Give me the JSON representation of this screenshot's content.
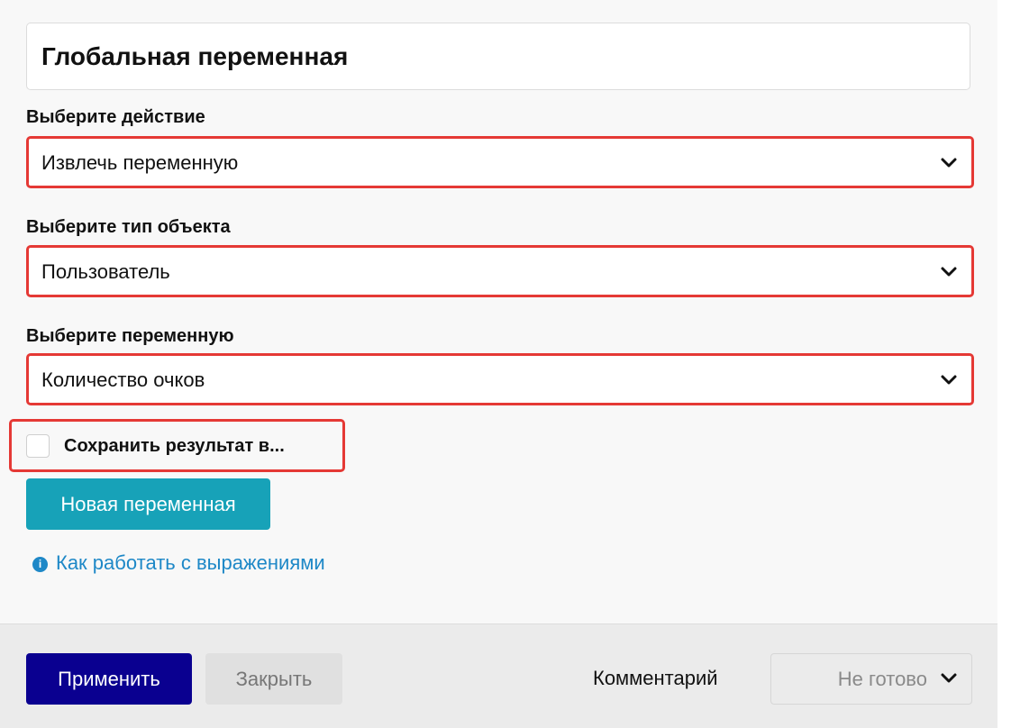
{
  "header": {
    "title": "Глобальная переменная"
  },
  "fields": {
    "action": {
      "label": "Выберите действие",
      "value": "Извлечь переменную"
    },
    "object_type": {
      "label": "Выберите тип объекта",
      "value": "Пользователь"
    },
    "variable": {
      "label": "Выберите переменную",
      "value": "Количество очков"
    }
  },
  "save_result": {
    "label": "Сохранить результат в...",
    "checked": false
  },
  "buttons": {
    "new_variable": "Новая переменная"
  },
  "help": {
    "icon": "info-icon",
    "icon_glyph": "i",
    "link_text": "Как работать с выражениями"
  },
  "footer": {
    "apply_label": "Применить",
    "close_label": "Закрыть",
    "comment_label": "Комментарий",
    "status_value": "Не готово"
  },
  "colors": {
    "highlight_border": "#e53935",
    "primary_button": "#0a0090",
    "accent_button": "#17a2b8",
    "link": "#1e88c7"
  }
}
